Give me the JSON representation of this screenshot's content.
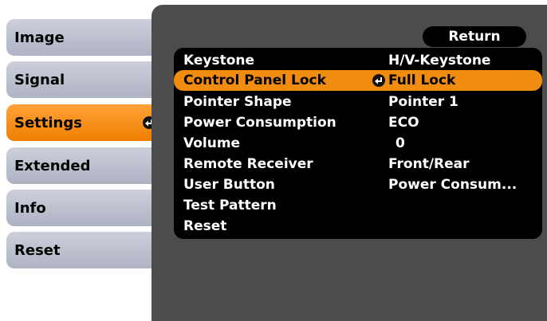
{
  "sidebar": {
    "items": [
      {
        "label": "Image"
      },
      {
        "label": "Signal"
      },
      {
        "label": "Settings"
      },
      {
        "label": "Extended"
      },
      {
        "label": "Info"
      },
      {
        "label": "Reset"
      }
    ],
    "active_item": "Settings"
  },
  "panel": {
    "return_label": "Return",
    "rows": [
      {
        "label": "Keystone",
        "value": "H/V-Keystone"
      },
      {
        "label": "Control Panel Lock",
        "value": "Full Lock"
      },
      {
        "label": "Pointer Shape",
        "value": "Pointer 1"
      },
      {
        "label": "Power Consumption",
        "value": "ECO"
      },
      {
        "label": "Volume",
        "value": "0"
      },
      {
        "label": "Remote Receiver",
        "value": "Front/Rear"
      },
      {
        "label": "User Button",
        "value": "Power Consum..."
      },
      {
        "label": "Test Pattern",
        "value": ""
      },
      {
        "label": "Reset",
        "value": ""
      }
    ],
    "selected_row": "Control Panel Lock"
  },
  "icons": {
    "sidebar_enter": "enter-icon",
    "selection_enter": "enter-icon"
  },
  "colors": {
    "highlight": "#f08c10",
    "tab_inactive": "#bfc2cf",
    "panel_bg": "#4c4c4c",
    "menu_bg": "#000000"
  }
}
